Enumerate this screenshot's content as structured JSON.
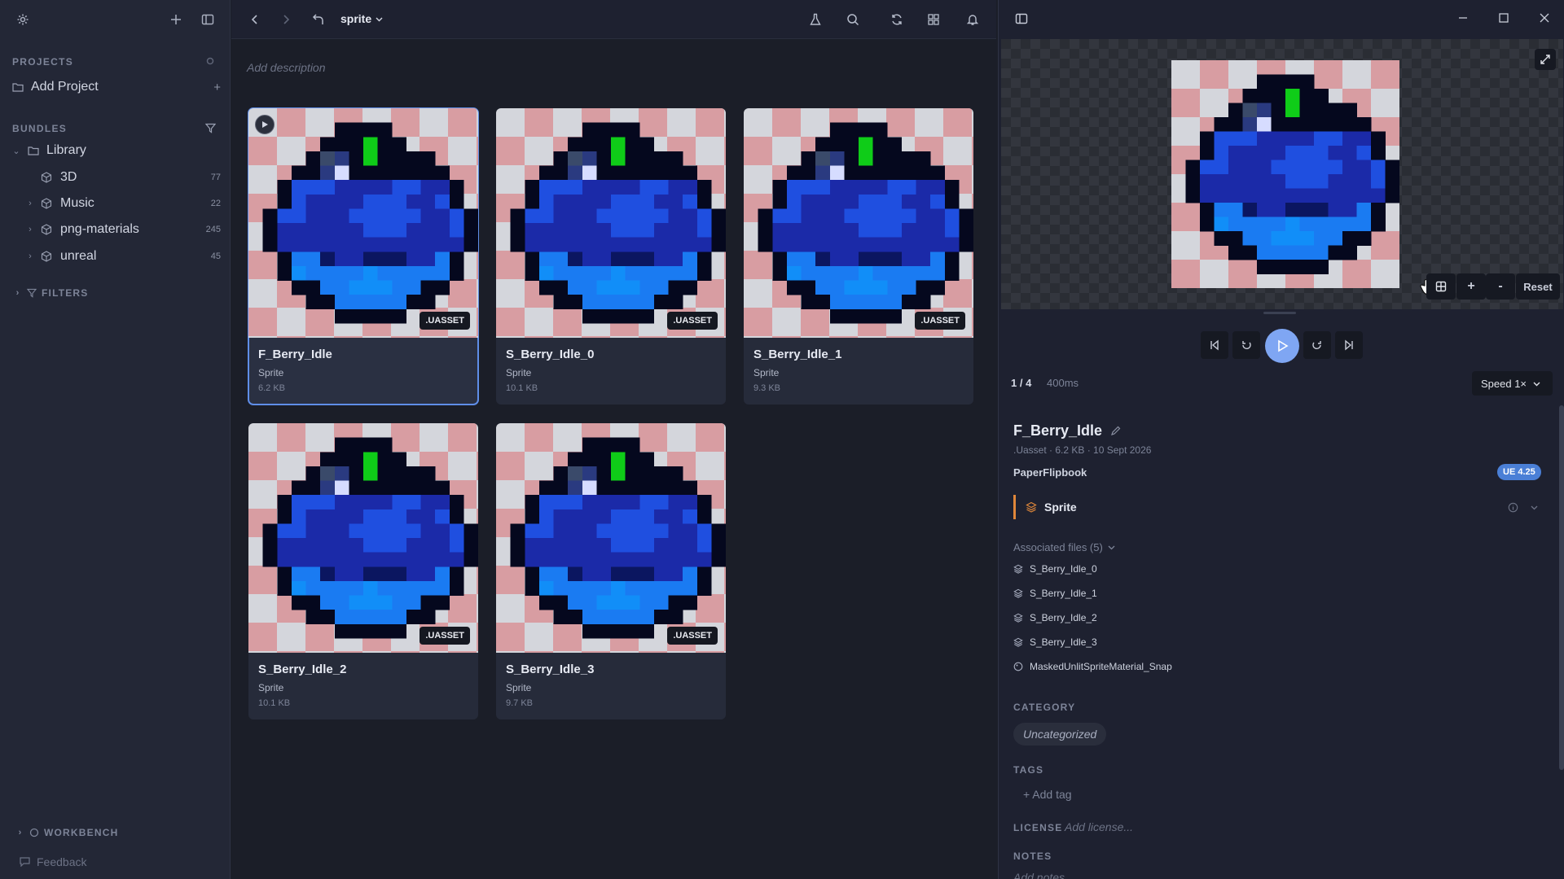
{
  "sidebar": {
    "projects_title": "PROJECTS",
    "add_project": "Add Project",
    "bundles_title": "BUNDLES",
    "library_label": "Library",
    "items": [
      {
        "label": "3D",
        "count": "77"
      },
      {
        "label": "Music",
        "count": "22"
      },
      {
        "label": "png-materials",
        "count": "245"
      },
      {
        "label": "unreal",
        "count": "45"
      }
    ],
    "filters_label": "FILTERS",
    "workbench_label": "WORKBENCH",
    "feedback_label": "Feedback"
  },
  "topbar": {
    "folder": "sprite",
    "description_placeholder": "Add description"
  },
  "assets": [
    {
      "name": "F_Berry_Idle",
      "type": "Sprite",
      "size": "6.2 KB",
      "badge": ".UASSET"
    },
    {
      "name": "S_Berry_Idle_0",
      "type": "Sprite",
      "size": "10.1 KB",
      "badge": ".UASSET"
    },
    {
      "name": "S_Berry_Idle_1",
      "type": "Sprite",
      "size": "9.3 KB",
      "badge": ".UASSET"
    },
    {
      "name": "S_Berry_Idle_2",
      "type": "Sprite",
      "size": "10.1 KB",
      "badge": ".UASSET"
    },
    {
      "name": "S_Berry_Idle_3",
      "type": "Sprite",
      "size": "9.7 KB",
      "badge": ".UASSET"
    }
  ],
  "preview": {
    "reset_label": "Reset",
    "zoom_in": "+",
    "zoom_out": "-",
    "frame": "1 / 4",
    "duration": "400ms",
    "speed": "Speed 1×"
  },
  "details": {
    "title": "F_Berry_Idle",
    "meta": ".Uasset · 6.2 KB · 10 Sept 2026",
    "class_name": "PaperFlipbook",
    "engine_badge": "UE 4.25",
    "type_label": "Sprite",
    "associated_title": "Associated files (5)",
    "associated": [
      "S_Berry_Idle_0",
      "S_Berry_Idle_1",
      "S_Berry_Idle_2",
      "S_Berry_Idle_3",
      "MaskedUnlitSpriteMaterial_Snap"
    ],
    "category_title": "CATEGORY",
    "category_value": "Uncategorized",
    "tags_title": "TAGS",
    "add_tag": "+ Add tag",
    "license_title": "LICENSE",
    "license_placeholder": "Add license...",
    "notes_title": "NOTES",
    "notes_placeholder": "Add notes..."
  },
  "colors": {
    "accent": "#5f8ee8",
    "badge_blue": "#4a7fd6",
    "sprite_orange": "#e0873a"
  }
}
